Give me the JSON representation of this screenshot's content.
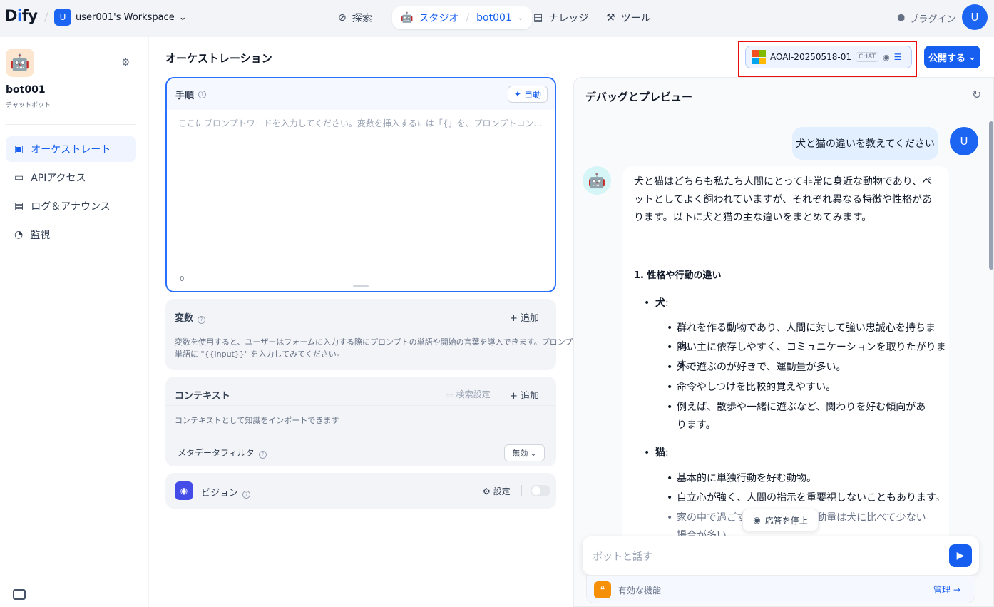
{
  "header": {
    "logo_main": "Dify",
    "workspace_initial": "U",
    "workspace_name": "user001's Workspace",
    "nav": {
      "explore": "探索",
      "studio": "スタジオ",
      "app_crumb": "bot001",
      "knowledge": "ナレッジ",
      "tools": "ツール"
    },
    "plugins": "プラグイン",
    "user_initial": "U"
  },
  "sidebar": {
    "app_name": "bot001",
    "app_type": "チャットボット",
    "items": [
      {
        "label": "オーケストレート",
        "active": true
      },
      {
        "label": "APIアクセス"
      },
      {
        "label": "ログ＆アナウンス"
      },
      {
        "label": "監視"
      }
    ]
  },
  "orchestration": {
    "title": "オーケストレーション",
    "model": {
      "name": "AOAI-20250518-01",
      "tag": "CHAT"
    },
    "publish": "公開する",
    "prompt": {
      "title": "手順",
      "auto": "自動",
      "placeholder": "ここにプロンプトワードを入力してください。変数を挿入するには「{」を、プロンプトコンテンツブロックを挿...",
      "count": "0"
    },
    "variables": {
      "title": "変数",
      "add": "追加",
      "desc1": "変数を使用すると、ユーザーはフォームに入力する際にプロンプトの単語や開始の言葉を導入できます。プロンプトの",
      "desc2": "単語に \"{{input}}\" を入力してみてください。"
    },
    "context": {
      "title": "コンテキスト",
      "search": "検索設定",
      "add": "追加",
      "desc": "コンテキストとして知識をインポートできます",
      "metadata": "メタデータフィルタ",
      "metadata_value": "無効"
    },
    "vision": {
      "title": "ビジョン",
      "settings": "設定",
      "enabled": false
    }
  },
  "debug": {
    "title": "デバッグとプレビュー",
    "user_initial": "U",
    "user_msg": "犬と猫の違いを教えてください",
    "bot_intro": "犬と猫はどちらも私たち人間にとって非常に身近な動物であり、ペットとしてよく飼われていますが、それぞれ異なる特徴や性格があります。以下に犬と猫の主な違いをまとめてみます。",
    "heading": "1. 性格や行動の違い",
    "dog": "犬",
    "dog_items": [
      "群れを作る動物であり、人間に対して強い忠誠心を持ちます。",
      "飼い主に依存しやすく、コミュニケーションを取りたがります。",
      "外で遊ぶのが好きで、運動量が多い。",
      "命令やしつけを比較的覚えやすい。",
      "例えば、散歩や一緒に遊ぶなど、関わりを好む傾向があります。"
    ],
    "cat": "猫",
    "cat_items": [
      "基本的に単独行動を好む動物。",
      "自立心が強く、人間の指示を重要視しないこともあります。",
      "家の中で過ごすことが多く、運動量は犬に比べて少ない場合が多い。"
    ],
    "stop": "応答を停止",
    "placeholder": "ボットと話す",
    "features": "有効な機能",
    "manage": "管理"
  }
}
